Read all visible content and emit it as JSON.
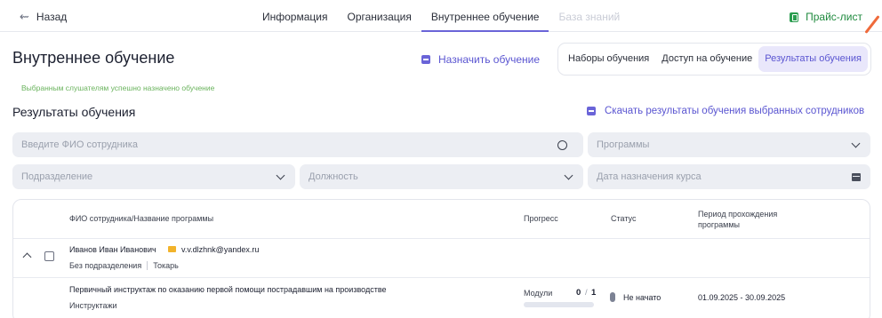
{
  "nav": {
    "back_label": "Назад",
    "tabs": [
      {
        "label": "Информация",
        "state": "normal"
      },
      {
        "label": "Организация",
        "state": "normal"
      },
      {
        "label": "Внутреннее обучение",
        "state": "active"
      },
      {
        "label": "База знаний",
        "state": "disabled"
      }
    ],
    "price_list_label": "Прайс-лист"
  },
  "page": {
    "title": "Внутреннее обучение",
    "assign_label": "Назначить обучение",
    "segments": [
      {
        "label": "Наборы обучения",
        "active": false
      },
      {
        "label": "Доступ на обучение",
        "active": false
      },
      {
        "label": "Результаты обучения",
        "active": true
      }
    ],
    "success_message": "Выбранным слушателям успешно назначено обучение"
  },
  "results": {
    "title": "Результаты обучения",
    "download_label": "Скачать результаты обучения выбранных сотрудников",
    "filters": {
      "search_placeholder": "Введите ФИО сотрудника",
      "programs_placeholder": "Программы",
      "department_placeholder": "Подразделение",
      "position_placeholder": "Должность",
      "date_placeholder": "Дата назначения курса"
    },
    "table": {
      "headers": {
        "name": "ФИО сотрудника/Название программы",
        "progress": "Прогресс",
        "status": "Статус",
        "period": "Период прохождения программы"
      },
      "employee": {
        "name": "Иванов Иван Иванович",
        "email": "v.v.dlzhnk@yandex.ru",
        "department": "Без подразделения",
        "position": "Токарь"
      },
      "program": {
        "name": "Первичный инструктаж по оказанию первой помощи пострадавшим на производстве",
        "category": "Инструктажи",
        "progress_label": "Модули",
        "progress_done": "0",
        "progress_sep": "/",
        "progress_total": "1",
        "progress_fraction": 0,
        "status": "Не начато",
        "period": "01.09.2025 - 30.09.2025"
      }
    }
  },
  "colors": {
    "accent": "#6a64d8",
    "success": "#6ab35d",
    "price": "#1f8a3e",
    "pointer": "#ef6a3b"
  }
}
